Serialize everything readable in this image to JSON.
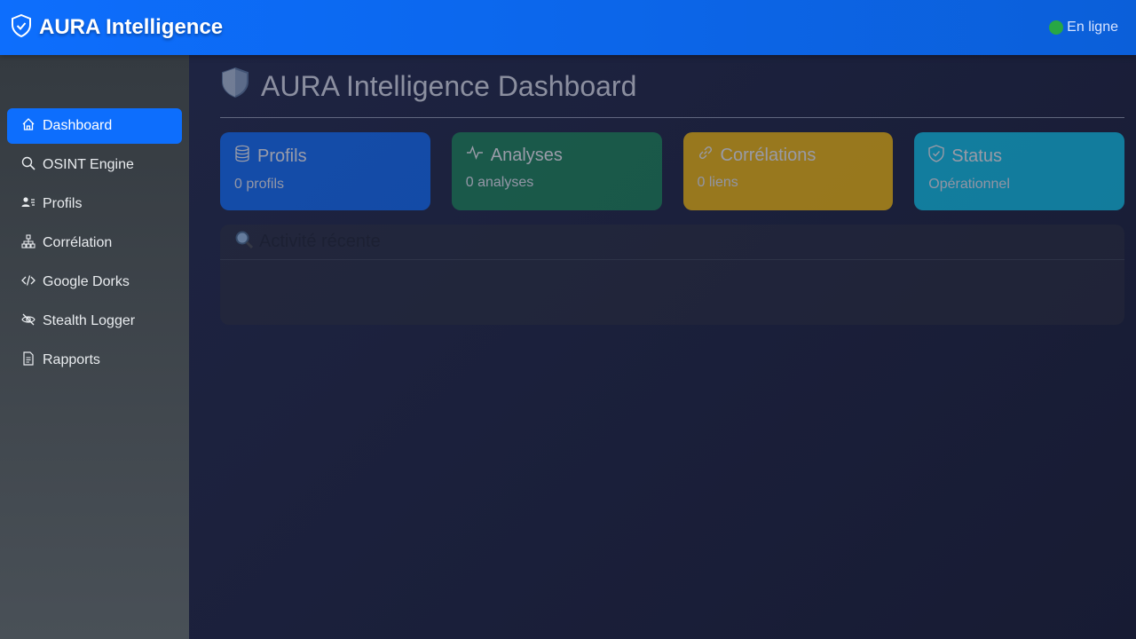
{
  "header": {
    "brand": "AURA Intelligence",
    "status": "En ligne",
    "status_color": "#28a745"
  },
  "sidebar": {
    "items": [
      {
        "label": "Dashboard",
        "icon": "home-icon",
        "active": true
      },
      {
        "label": "OSINT Engine",
        "icon": "search-icon"
      },
      {
        "label": "Profils",
        "icon": "user-list-icon"
      },
      {
        "label": "Corrélation",
        "icon": "network-icon"
      },
      {
        "label": "Google Dorks",
        "icon": "code-icon"
      },
      {
        "label": "Stealth Logger",
        "icon": "eye-slash-icon"
      },
      {
        "label": "Rapports",
        "icon": "document-icon"
      }
    ]
  },
  "main": {
    "title": "AURA Intelligence Dashboard",
    "cards": [
      {
        "title": "Profils",
        "value": "0 profils",
        "color": "#0d6efd",
        "icon": "database-icon"
      },
      {
        "title": "Analyses",
        "value": "0 analyses",
        "color": "#198754",
        "icon": "activity-icon"
      },
      {
        "title": "Corrélations",
        "value": "0 liens",
        "color": "#ffc107",
        "icon": "link-icon"
      },
      {
        "title": "Status",
        "value": "Opérationnel",
        "color": "#0dcaf0",
        "icon": "shield-check-icon"
      }
    ],
    "activity": {
      "title": "Activité récente"
    }
  }
}
